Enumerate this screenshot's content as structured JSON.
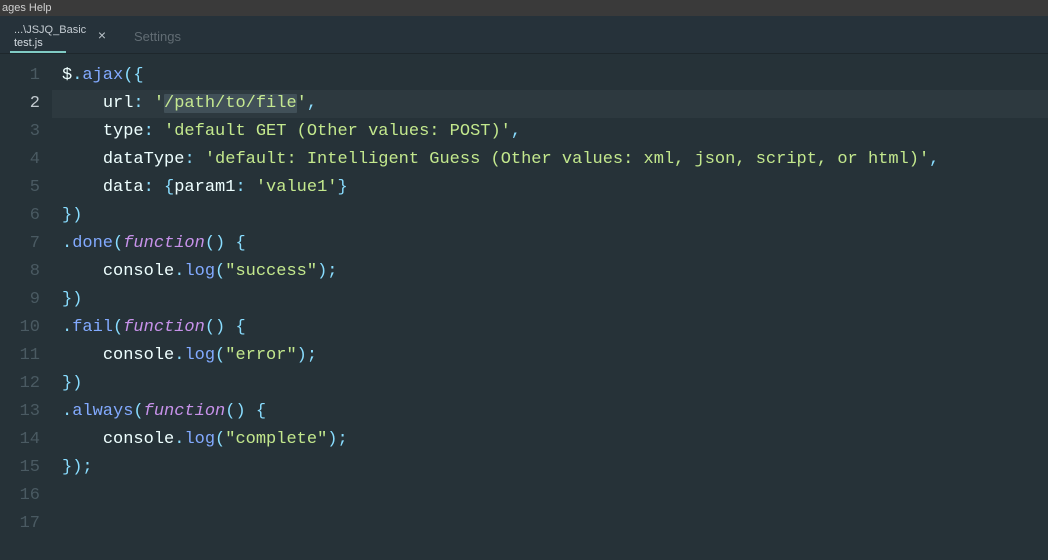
{
  "menubar": {
    "text": "ages   Help"
  },
  "tabs": {
    "active": {
      "path": "...\\JSJQ_Basic",
      "file": "test.js",
      "close": "×"
    },
    "other": {
      "label": "Settings"
    }
  },
  "editor": {
    "current_line": 2,
    "total_lines": 17,
    "selection": "/path/to/file",
    "code": {
      "l1": {
        "a": "$",
        "b": ".",
        "c": "ajax",
        "d": "({"
      },
      "l2": {
        "indent": "    ",
        "a": "url",
        "b": ": ",
        "q": "'",
        "s1": "/path/to/file",
        "c": ","
      },
      "l3": {
        "indent": "    ",
        "a": "type",
        "b": ": ",
        "s": "'default GET (Other values: POST)'",
        "c": ","
      },
      "l4": {
        "indent": "    ",
        "a": "dataType",
        "b": ": ",
        "s": "'default: Intelligent Guess (Other values: xml, json, script, or html)'",
        "c": ","
      },
      "l5": {
        "indent": "    ",
        "a": "data",
        "b": ": {",
        "p": "param1",
        "c": ": ",
        "s": "'value1'",
        "d": "}"
      },
      "l6": {
        "a": "})"
      },
      "l7": {
        "a": ".",
        "b": "done",
        "c": "(",
        "d": "function",
        "e": "() {"
      },
      "l8": {
        "indent": "    ",
        "a": "console",
        "b": ".",
        "c": "log",
        "d": "(",
        "s": "\"success\"",
        "e": ");"
      },
      "l9": {
        "a": "})"
      },
      "l10": {
        "a": ".",
        "b": "fail",
        "c": "(",
        "d": "function",
        "e": "() {"
      },
      "l11": {
        "indent": "    ",
        "a": "console",
        "b": ".",
        "c": "log",
        "d": "(",
        "s": "\"error\"",
        "e": ");"
      },
      "l12": {
        "a": "})"
      },
      "l13": {
        "a": ".",
        "b": "always",
        "c": "(",
        "d": "function",
        "e": "() {"
      },
      "l14": {
        "indent": "    ",
        "a": "console",
        "b": ".",
        "c": "log",
        "d": "(",
        "s": "\"complete\"",
        "e": ");"
      },
      "l15": {
        "a": "});"
      }
    }
  }
}
